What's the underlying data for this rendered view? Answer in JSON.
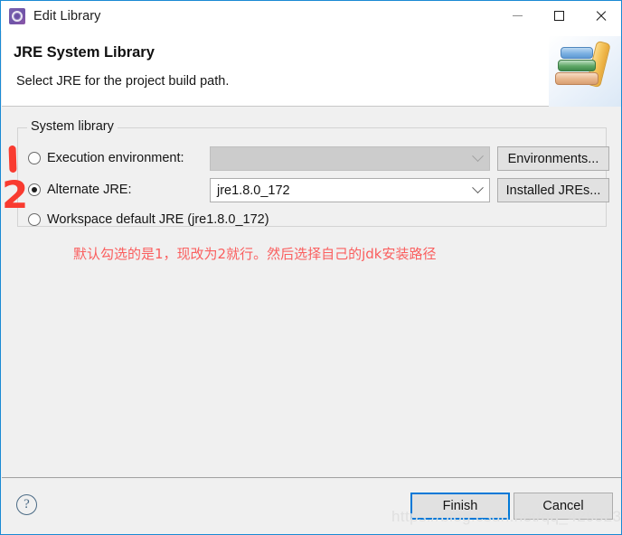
{
  "window": {
    "title": "Edit Library",
    "app_icon": "eclipse-gear-icon",
    "controls": {
      "minimize": "minimize-icon",
      "maximize": "maximize-icon",
      "close": "close-icon"
    },
    "border_color": "#1a8ad4"
  },
  "header": {
    "title": "JRE System Library",
    "description": "Select JRE for the project build path.",
    "art_icon": "book-stack-icon"
  },
  "group": {
    "legend": "System library",
    "options": [
      {
        "label": "Execution environment:",
        "selected": false,
        "combo_value": "",
        "combo_disabled": true,
        "button": "Environments..."
      },
      {
        "label": "Alternate JRE:",
        "selected": true,
        "combo_value": "jre1.8.0_172",
        "combo_disabled": false,
        "button": "Installed JREs..."
      },
      {
        "label": "Workspace default JRE (jre1.8.0_172)",
        "selected": false
      }
    ]
  },
  "annotations": {
    "mark_one": "1",
    "mark_two": "2",
    "note": "默认勾选的是1，现改为2就行。然后选择自己的jdk安装路径",
    "note_color": "#fa5f5f",
    "mark_color": "#f93b30"
  },
  "footer": {
    "help": "?",
    "finish_label": "Finish",
    "cancel_label": "Cancel",
    "focus_color": "#0078d7"
  },
  "watermark": {
    "text": "https://blog.csdn.net/qq_42952331"
  }
}
